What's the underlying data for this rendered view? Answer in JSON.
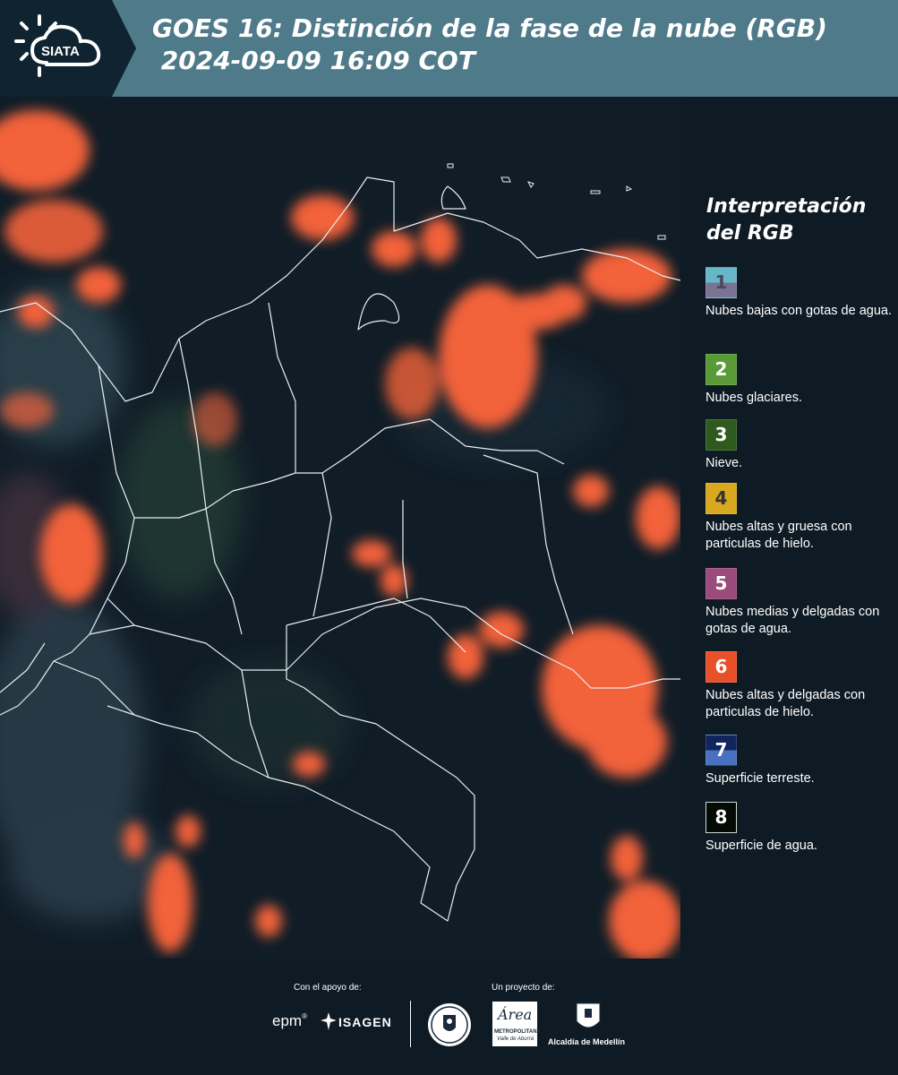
{
  "header": {
    "logo_text": "SIATA",
    "title_line1": "GOES 16: Distinción de la fase de la nube (RGB)",
    "title_line2": " 2024-09-09 16:09 COT"
  },
  "legend": {
    "title": "Interpretación del RGB",
    "items": [
      {
        "num": "1",
        "label": "Nubes bajas con gotas de agua.",
        "top_color": "#66b8c8",
        "bottom_color": "#7a7394",
        "num_color": "#4a4a5a"
      },
      {
        "num": "2",
        "label": "Nubes glaciares.",
        "top_color": "#5a9a36",
        "bottom_color": "#5a9a36",
        "num_color": "#ffffff"
      },
      {
        "num": "3",
        "label": "Nieve.",
        "top_color": "#2e5a1e",
        "bottom_color": "#2e5a1e",
        "num_color": "#ffffff"
      },
      {
        "num": "4",
        "label": "Nubes altas y gruesa con particulas de hielo.",
        "top_color": "#d8a91e",
        "bottom_color": "#d8a91e",
        "num_color": "#333333"
      },
      {
        "num": "5",
        "label": "Nubes medias y delgadas con gotas de agua.",
        "top_color": "#9b4a7c",
        "bottom_color": "#9b4a7c",
        "num_color": "#ffffff"
      },
      {
        "num": "6",
        "label": "Nubes altas y delgadas con particulas de hielo.",
        "top_color": "#e8502a",
        "bottom_color": "#e8502a",
        "num_color": "#ffffff"
      },
      {
        "num": "7",
        "label": "Superficie terreste.",
        "top_color": "#10245e",
        "bottom_color": "#4a70c0",
        "num_color": "#ffffff"
      },
      {
        "num": "8",
        "label": "Superficie de agua.",
        "top_color": "#050a05",
        "bottom_color": "#050a05",
        "num_color": "#ffffff"
      }
    ]
  },
  "footer": {
    "support_label": "Con el apoyo de:",
    "project_label": "Un proyecto de:",
    "epm": "epm",
    "isagen": "ISAGEN",
    "area_name": "Área",
    "area_sub": "METROPOLITANA",
    "area_sub2": "Valle de Aburrá",
    "alcaldia": "Alcaldía de Medellín"
  },
  "colors": {
    "header_bg": "#4f7a8a",
    "logo_bg": "#0f2330",
    "panel_bg": "#0e1b24",
    "cloud": "#ff6a3a"
  }
}
